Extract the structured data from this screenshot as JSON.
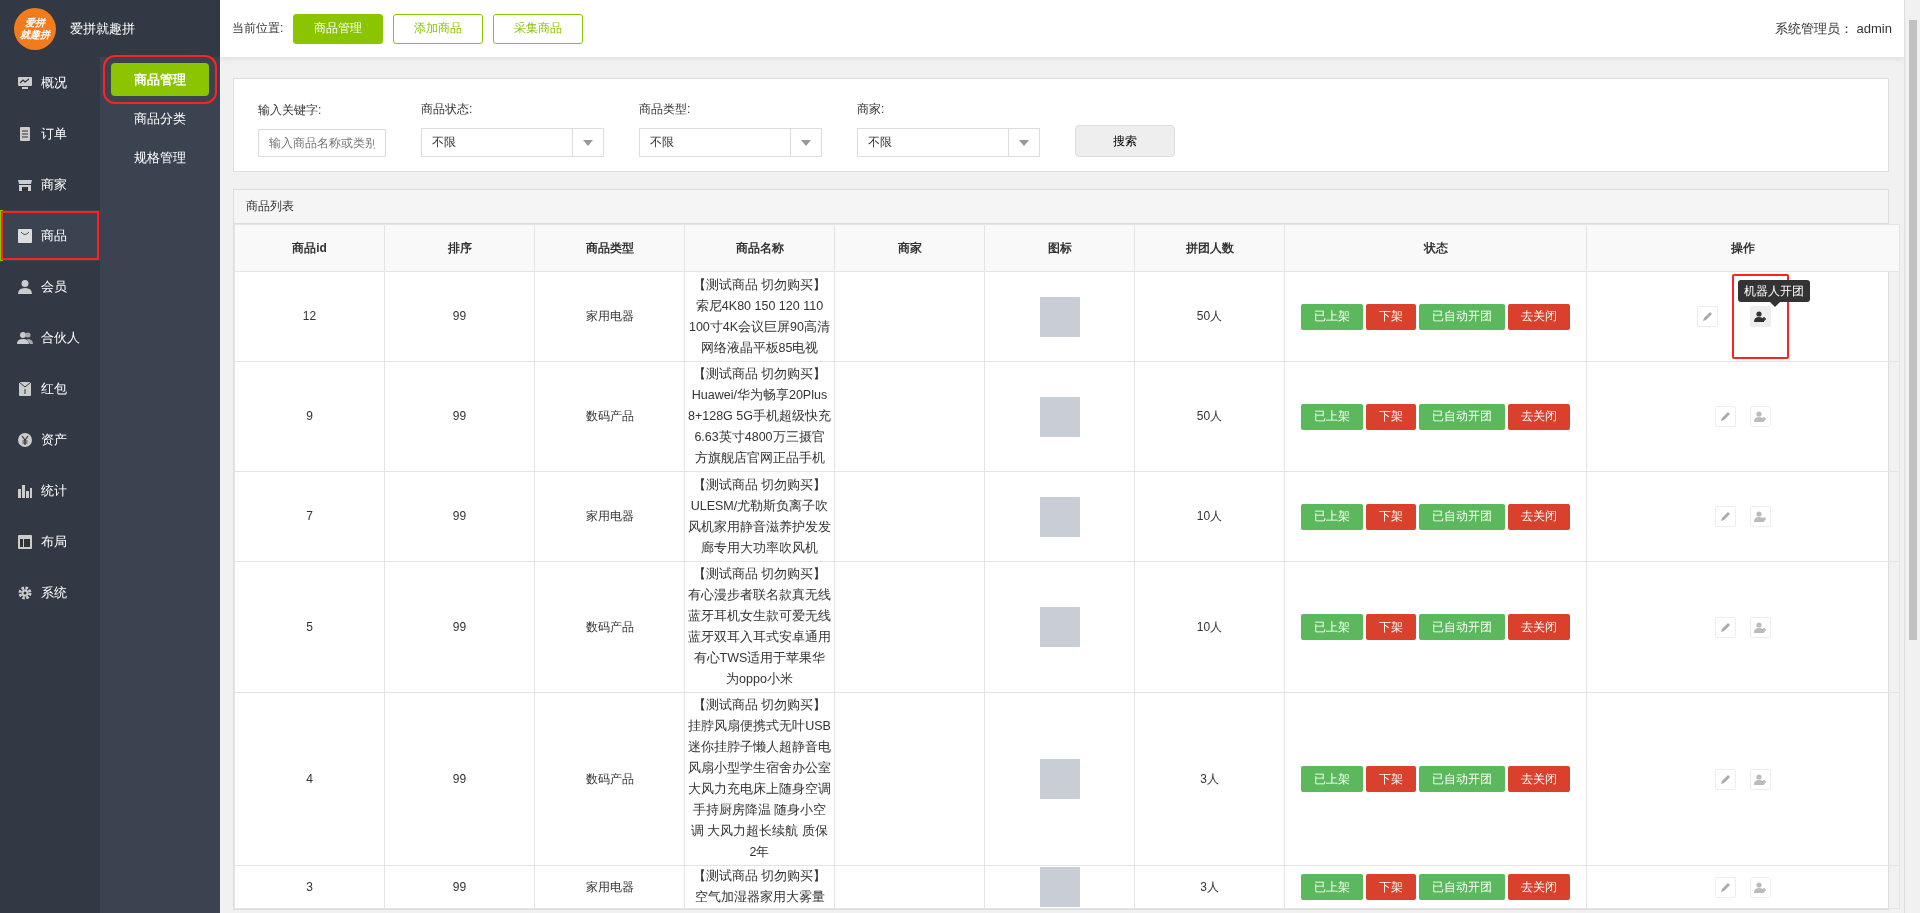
{
  "brand": {
    "logo_lines": [
      "爱拼",
      "就趣拼"
    ],
    "title": "爱拼就趣拼"
  },
  "nav": [
    {
      "label": "概况",
      "selected": false,
      "highlighted": false
    },
    {
      "label": "订单",
      "selected": false,
      "highlighted": false
    },
    {
      "label": "商家",
      "selected": false,
      "highlighted": false
    },
    {
      "label": "商品",
      "selected": true,
      "highlighted": true
    },
    {
      "label": "会员",
      "selected": false,
      "highlighted": false
    },
    {
      "label": "合伙人",
      "selected": false,
      "highlighted": false
    },
    {
      "label": "红包",
      "selected": false,
      "highlighted": false
    },
    {
      "label": "资产",
      "selected": false,
      "highlighted": false
    },
    {
      "label": "统计",
      "selected": false,
      "highlighted": false
    },
    {
      "label": "布局",
      "selected": false,
      "highlighted": false
    },
    {
      "label": "系统",
      "selected": false,
      "highlighted": false
    }
  ],
  "submenu": [
    {
      "label": "商品管理",
      "selected": true,
      "highlighted": true
    },
    {
      "label": "商品分类",
      "selected": false,
      "highlighted": false
    },
    {
      "label": "规格管理",
      "selected": false,
      "highlighted": false
    }
  ],
  "topbar": {
    "breadcrumb_label": "当前位置:",
    "tabs": [
      {
        "label": "商品管理",
        "selected": true
      },
      {
        "label": "添加商品",
        "selected": false
      },
      {
        "label": "采集商品",
        "selected": false
      }
    ],
    "user_label": "系统管理员：",
    "user": "admin"
  },
  "filters": {
    "keyword": {
      "label": "输入关键字:",
      "placeholder": "输入商品名称或类别"
    },
    "selects": [
      {
        "label": "商品状态:",
        "value": "不限"
      },
      {
        "label": "商品类型:",
        "value": "不限"
      },
      {
        "label": "商家:",
        "value": "不限"
      }
    ],
    "search_button": "搜索"
  },
  "table": {
    "title": "商品列表",
    "columns": [
      "商品id",
      "排序",
      "商品类型",
      "商品名称",
      "商家",
      "图标",
      "拼团人数",
      "状态",
      "操作"
    ],
    "rows": [
      {
        "id": "12",
        "sort": "99",
        "type": "家用电器",
        "name": "【测试商品 切勿购买】索尼4K80 150 120 110 100寸4K会议巨屏90高清网络液晶平板85电视",
        "group_size": "50人",
        "status": [
          {
            "label": "已上架",
            "color": "#5cb85c"
          },
          {
            "label": "下架",
            "color": "#d9412c"
          },
          {
            "label": "已自动开团",
            "color": "#5cb85c"
          },
          {
            "label": "去关闭",
            "color": "#d9412c"
          }
        ],
        "robot_tooltip": "机器人开团",
        "highlighted": true
      },
      {
        "id": "9",
        "sort": "99",
        "type": "数码产品",
        "name": "【测试商品 切勿购买】Huawei/华为畅享20Plus 8+128G 5G手机超级快充6.63英寸4800万三摄官方旗舰店官网正品手机",
        "group_size": "50人",
        "status": [
          {
            "label": "已上架",
            "color": "#5cb85c"
          },
          {
            "label": "下架",
            "color": "#d9412c"
          },
          {
            "label": "已自动开团",
            "color": "#5cb85c"
          },
          {
            "label": "去关闭",
            "color": "#d9412c"
          }
        ],
        "highlighted": false
      },
      {
        "id": "7",
        "sort": "99",
        "type": "家用电器",
        "name": "【测试商品 切勿购买】ULESM/尤勒斯负离子吹风机家用静音滋养护发发廊专用大功率吹风机",
        "group_size": "10人",
        "status": [
          {
            "label": "已上架",
            "color": "#5cb85c"
          },
          {
            "label": "下架",
            "color": "#d9412c"
          },
          {
            "label": "已自动开团",
            "color": "#5cb85c"
          },
          {
            "label": "去关闭",
            "color": "#d9412c"
          }
        ],
        "highlighted": false
      },
      {
        "id": "5",
        "sort": "99",
        "type": "数码产品",
        "name": "【测试商品 切勿购买】有心漫步者联名款真无线蓝牙耳机女生款可爱无线蓝牙双耳入耳式安卓通用有心TWS适用于苹果华为oppo小米",
        "group_size": "10人",
        "status": [
          {
            "label": "已上架",
            "color": "#5cb85c"
          },
          {
            "label": "下架",
            "color": "#d9412c"
          },
          {
            "label": "已自动开团",
            "color": "#5cb85c"
          },
          {
            "label": "去关闭",
            "color": "#d9412c"
          }
        ],
        "highlighted": false
      },
      {
        "id": "4",
        "sort": "99",
        "type": "数码产品",
        "name": "【测试商品 切勿购买】挂脖风扇便携式无叶USB迷你挂脖子懒人超静音电风扇小型学生宿舍办公室大风力充电床上随身空调手持厨房降温 随身小空调 大风力超长续航 质保2年",
        "group_size": "3人",
        "status": [
          {
            "label": "已上架",
            "color": "#5cb85c"
          },
          {
            "label": "下架",
            "color": "#d9412c"
          },
          {
            "label": "已自动开团",
            "color": "#5cb85c"
          },
          {
            "label": "去关闭",
            "color": "#d9412c"
          }
        ],
        "highlighted": false
      },
      {
        "id": "3",
        "sort": "99",
        "type": "家用电器",
        "name": "【测试商品 切勿购买】空气加湿器家用大雾量",
        "group_size": "3人",
        "status": [
          {
            "label": "已上架",
            "color": "#5cb85c"
          },
          {
            "label": "下架",
            "color": "#d9412c"
          },
          {
            "label": "已自动开团",
            "color": "#5cb85c"
          },
          {
            "label": "去关闭",
            "color": "#d9412c"
          }
        ],
        "highlighted": false
      }
    ]
  }
}
